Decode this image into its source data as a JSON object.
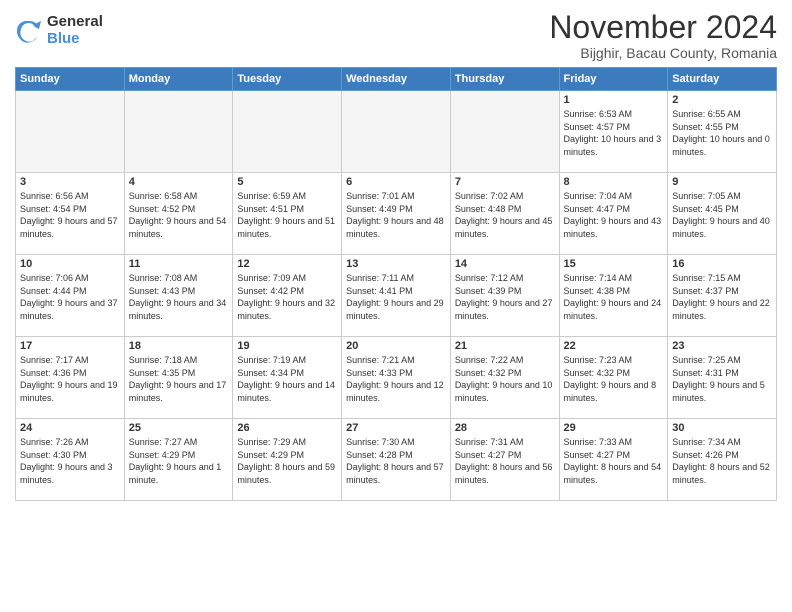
{
  "logo": {
    "general": "General",
    "blue": "Blue"
  },
  "title": "November 2024",
  "subtitle": "Bijghir, Bacau County, Romania",
  "days_of_week": [
    "Sunday",
    "Monday",
    "Tuesday",
    "Wednesday",
    "Thursday",
    "Friday",
    "Saturday"
  ],
  "weeks": [
    [
      {
        "day": "",
        "info": ""
      },
      {
        "day": "",
        "info": ""
      },
      {
        "day": "",
        "info": ""
      },
      {
        "day": "",
        "info": ""
      },
      {
        "day": "",
        "info": ""
      },
      {
        "day": "1",
        "info": "Sunrise: 6:53 AM\nSunset: 4:57 PM\nDaylight: 10 hours and 3 minutes."
      },
      {
        "day": "2",
        "info": "Sunrise: 6:55 AM\nSunset: 4:55 PM\nDaylight: 10 hours and 0 minutes."
      }
    ],
    [
      {
        "day": "3",
        "info": "Sunrise: 6:56 AM\nSunset: 4:54 PM\nDaylight: 9 hours and 57 minutes."
      },
      {
        "day": "4",
        "info": "Sunrise: 6:58 AM\nSunset: 4:52 PM\nDaylight: 9 hours and 54 minutes."
      },
      {
        "day": "5",
        "info": "Sunrise: 6:59 AM\nSunset: 4:51 PM\nDaylight: 9 hours and 51 minutes."
      },
      {
        "day": "6",
        "info": "Sunrise: 7:01 AM\nSunset: 4:49 PM\nDaylight: 9 hours and 48 minutes."
      },
      {
        "day": "7",
        "info": "Sunrise: 7:02 AM\nSunset: 4:48 PM\nDaylight: 9 hours and 45 minutes."
      },
      {
        "day": "8",
        "info": "Sunrise: 7:04 AM\nSunset: 4:47 PM\nDaylight: 9 hours and 43 minutes."
      },
      {
        "day": "9",
        "info": "Sunrise: 7:05 AM\nSunset: 4:45 PM\nDaylight: 9 hours and 40 minutes."
      }
    ],
    [
      {
        "day": "10",
        "info": "Sunrise: 7:06 AM\nSunset: 4:44 PM\nDaylight: 9 hours and 37 minutes."
      },
      {
        "day": "11",
        "info": "Sunrise: 7:08 AM\nSunset: 4:43 PM\nDaylight: 9 hours and 34 minutes."
      },
      {
        "day": "12",
        "info": "Sunrise: 7:09 AM\nSunset: 4:42 PM\nDaylight: 9 hours and 32 minutes."
      },
      {
        "day": "13",
        "info": "Sunrise: 7:11 AM\nSunset: 4:41 PM\nDaylight: 9 hours and 29 minutes."
      },
      {
        "day": "14",
        "info": "Sunrise: 7:12 AM\nSunset: 4:39 PM\nDaylight: 9 hours and 27 minutes."
      },
      {
        "day": "15",
        "info": "Sunrise: 7:14 AM\nSunset: 4:38 PM\nDaylight: 9 hours and 24 minutes."
      },
      {
        "day": "16",
        "info": "Sunrise: 7:15 AM\nSunset: 4:37 PM\nDaylight: 9 hours and 22 minutes."
      }
    ],
    [
      {
        "day": "17",
        "info": "Sunrise: 7:17 AM\nSunset: 4:36 PM\nDaylight: 9 hours and 19 minutes."
      },
      {
        "day": "18",
        "info": "Sunrise: 7:18 AM\nSunset: 4:35 PM\nDaylight: 9 hours and 17 minutes."
      },
      {
        "day": "19",
        "info": "Sunrise: 7:19 AM\nSunset: 4:34 PM\nDaylight: 9 hours and 14 minutes."
      },
      {
        "day": "20",
        "info": "Sunrise: 7:21 AM\nSunset: 4:33 PM\nDaylight: 9 hours and 12 minutes."
      },
      {
        "day": "21",
        "info": "Sunrise: 7:22 AM\nSunset: 4:32 PM\nDaylight: 9 hours and 10 minutes."
      },
      {
        "day": "22",
        "info": "Sunrise: 7:23 AM\nSunset: 4:32 PM\nDaylight: 9 hours and 8 minutes."
      },
      {
        "day": "23",
        "info": "Sunrise: 7:25 AM\nSunset: 4:31 PM\nDaylight: 9 hours and 5 minutes."
      }
    ],
    [
      {
        "day": "24",
        "info": "Sunrise: 7:26 AM\nSunset: 4:30 PM\nDaylight: 9 hours and 3 minutes."
      },
      {
        "day": "25",
        "info": "Sunrise: 7:27 AM\nSunset: 4:29 PM\nDaylight: 9 hours and 1 minute."
      },
      {
        "day": "26",
        "info": "Sunrise: 7:29 AM\nSunset: 4:29 PM\nDaylight: 8 hours and 59 minutes."
      },
      {
        "day": "27",
        "info": "Sunrise: 7:30 AM\nSunset: 4:28 PM\nDaylight: 8 hours and 57 minutes."
      },
      {
        "day": "28",
        "info": "Sunrise: 7:31 AM\nSunset: 4:27 PM\nDaylight: 8 hours and 56 minutes."
      },
      {
        "day": "29",
        "info": "Sunrise: 7:33 AM\nSunset: 4:27 PM\nDaylight: 8 hours and 54 minutes."
      },
      {
        "day": "30",
        "info": "Sunrise: 7:34 AM\nSunset: 4:26 PM\nDaylight: 8 hours and 52 minutes."
      }
    ]
  ]
}
